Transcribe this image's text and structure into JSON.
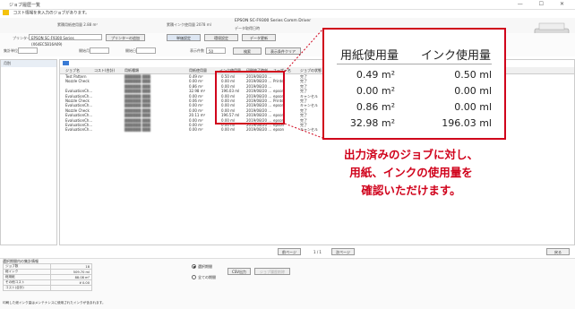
{
  "window": {
    "title": "ジョブ履歴一覧",
    "controls": "— ☐ ✕"
  },
  "notice": "コスト情報を未入力のジョブがあります。",
  "infobar": {
    "paper_total": "累積用紙使用量 2.88 m²",
    "ink_total": "累積インク使用量 2078 ml",
    "product": "EPSON SC-F9300 Series Comm Driver",
    "date": "データ取得日時"
  },
  "toolbar": {
    "printer_label": "プリンター",
    "printer_value": "EPSON SC-F9300 Series (X64EC5B16A09)",
    "add_printer": "プリンターの追加",
    "unit_setting": "単価設定",
    "history_setting": "環境設定",
    "data_update": "データ更新",
    "period_label": "集計単位",
    "start_label": "開始月",
    "end_label": "開始日",
    "display_label": "表示件数",
    "display_value": "50",
    "search": "検索",
    "clear": "表示条件クリア"
  },
  "sidebar": {
    "header": "月別"
  },
  "table": {
    "columns": [
      "ジョブ名",
      "コスト(合計)",
      "用紙種類",
      "用紙使用量",
      "インク使用量",
      "印刷終了時刻",
      "ユーザー名",
      "ジョブの状態"
    ],
    "rows": [
      {
        "name": "Test Pattern",
        "paper": "0.49 m²",
        "ink": "0.50 ml",
        "time": "2019/08/20 ...",
        "user": "",
        "state": "完了"
      },
      {
        "name": "Nozzle Check",
        "paper": "0.00 m²",
        "ink": "0.00 ml",
        "time": "2019/08/20 ...",
        "user": "Printer",
        "state": "完了"
      },
      {
        "name": "",
        "paper": "0.86 m²",
        "ink": "0.00 ml",
        "time": "2019/08/20 ...",
        "user": "",
        "state": "完了"
      },
      {
        "name": "EvaluationCh...",
        "paper": "32.98 m²",
        "ink": "196.03 ml",
        "time": "2019/08/20 ...",
        "user": "epson",
        "state": "完了"
      },
      {
        "name": "EvaluationCh...",
        "paper": "0.00 m²",
        "ink": "0.00 ml",
        "time": "2019/08/20 ...",
        "user": "epson",
        "state": "キャンセル"
      },
      {
        "name": "Nozzle Check",
        "paper": "0.06 m²",
        "ink": "0.00 ml",
        "time": "2019/08/20 ...",
        "user": "Printer",
        "state": "完了"
      },
      {
        "name": "EvaluationCh...",
        "paper": "0.00 m²",
        "ink": "0.00 ml",
        "time": "2019/08/20 ...",
        "user": "epson",
        "state": "キャンセル"
      },
      {
        "name": "Nozzle Check",
        "paper": "0.00 m²",
        "ink": "0.00 ml",
        "time": "2019/08/20 ...",
        "user": "",
        "state": "完了"
      },
      {
        "name": "EvaluationCh...",
        "paper": "20.11 m²",
        "ink": "196.57 ml",
        "time": "2019/08/20 ...",
        "user": "epson",
        "state": "完了"
      },
      {
        "name": "EvaluationCh...",
        "paper": "0.00 m²",
        "ink": "0.00 ml",
        "time": "2019/08/20 ...",
        "user": "epson",
        "state": "完了"
      },
      {
        "name": "EvaluationCh...",
        "paper": "0.00 m²",
        "ink": "0.00 ml",
        "time": "2019/08/20 ...",
        "user": "epson",
        "state": "完了"
      },
      {
        "name": "EvaluationCh...",
        "paper": "0.00 m²",
        "ink": "0.00 ml",
        "time": "2019/08/20 ...",
        "user": "epson",
        "state": "キャンセル"
      }
    ]
  },
  "pager": {
    "prev": "前ページ",
    "page": "1 / 1",
    "next": "次ページ",
    "back": "戻る"
  },
  "summary": {
    "title": "選択期間内の集計情報",
    "rows": [
      {
        "label": "ジョブ数",
        "value": "18"
      },
      {
        "label": "総インク",
        "value": "509.70 ml"
      },
      {
        "label": "総用紙",
        "value": "88.08 m²"
      },
      {
        "label": "その他コスト",
        "value": "¥ 0.00"
      },
      {
        "label": "コスト(合計)",
        "value": ""
      }
    ],
    "footnote": "印刷した総インク量はメンテナンスに使用されたインクが含まれます。",
    "radio_selected": "選択期間",
    "radio_all": "全ての期間",
    "csv_button": "CSV出力",
    "delete_button": "ジョブ履歴削除"
  },
  "callout": {
    "header_paper": "用紙使用量",
    "header_ink": "インク使用量",
    "rows": [
      {
        "paper": "0.49 m²",
        "ink": "0.50 ml"
      },
      {
        "paper": "0.00 m²",
        "ink": "0.00 ml"
      },
      {
        "paper": "0.86 m²",
        "ink": "0.00 ml"
      },
      {
        "paper": "32.98 m²",
        "ink": "196.03 ml"
      }
    ]
  },
  "description": {
    "line1": "出力済みのジョブに対し、",
    "line2": "用紙、インクの使用量を",
    "line3": "確認いただけます。"
  },
  "colors": {
    "highlight": "#d0021b",
    "warning": "#f4c20d"
  }
}
